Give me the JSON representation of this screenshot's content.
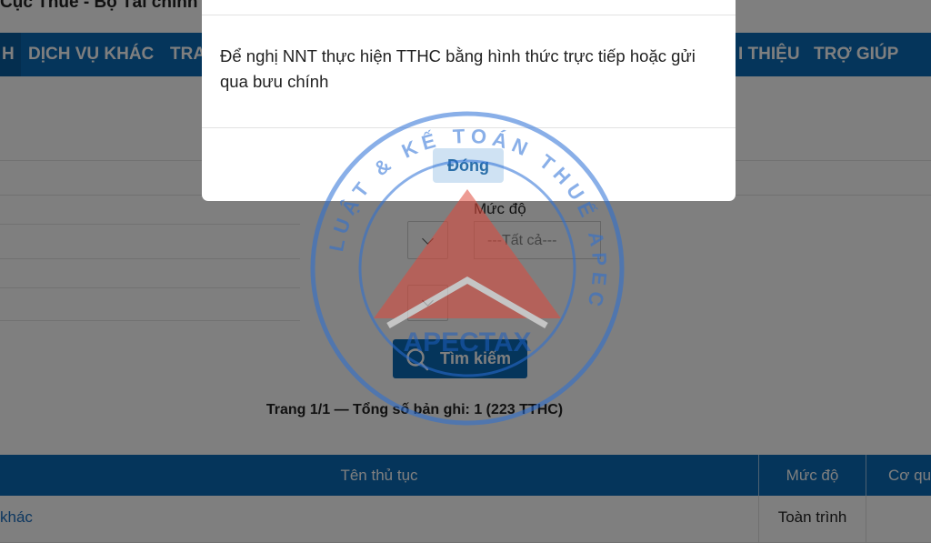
{
  "header": {
    "site_title": "Cục Thuế - Bộ Tài chính"
  },
  "nav": {
    "items": [
      {
        "label": "H"
      },
      {
        "label": "DỊCH VỤ KHÁC"
      },
      {
        "label": "TRA"
      },
      {
        "label": "I THIỆU"
      },
      {
        "label": "TRỢ GIÚP"
      }
    ]
  },
  "filters": {
    "muc_do_label": "Mức độ",
    "muc_do_value": "---Tất cả---"
  },
  "search": {
    "button_label": "Tìm kiếm",
    "icon": "search-icon"
  },
  "paging": {
    "text": "Trang 1/1 — Tổng số bản ghi: 1 (223 TTHC)"
  },
  "table": {
    "headers": [
      "Tên thủ tục",
      "Mức độ",
      "Cơ qu"
    ],
    "rows": [
      {
        "name": "khác",
        "level": "Toàn trình",
        "agency": ""
      }
    ]
  },
  "modal": {
    "message": "Để nghị NNT thực hiện TTHC bằng hình thức trực tiếp hoặc gửi qua bưu chính",
    "close_label": "Đóng"
  },
  "watermark": {
    "ring_text": "LUẬT & KẾ TOÁN THUẾ APEC",
    "brand": "APECTAX",
    "colors": {
      "ring": "#2a6fd6",
      "triangle": "#e04a3c",
      "brand": "#1e5fbf"
    }
  },
  "colors": {
    "primary": "#0b6bb6",
    "overlay": "rgba(0,0,0,0.5)",
    "link": "#1b6fc0"
  }
}
